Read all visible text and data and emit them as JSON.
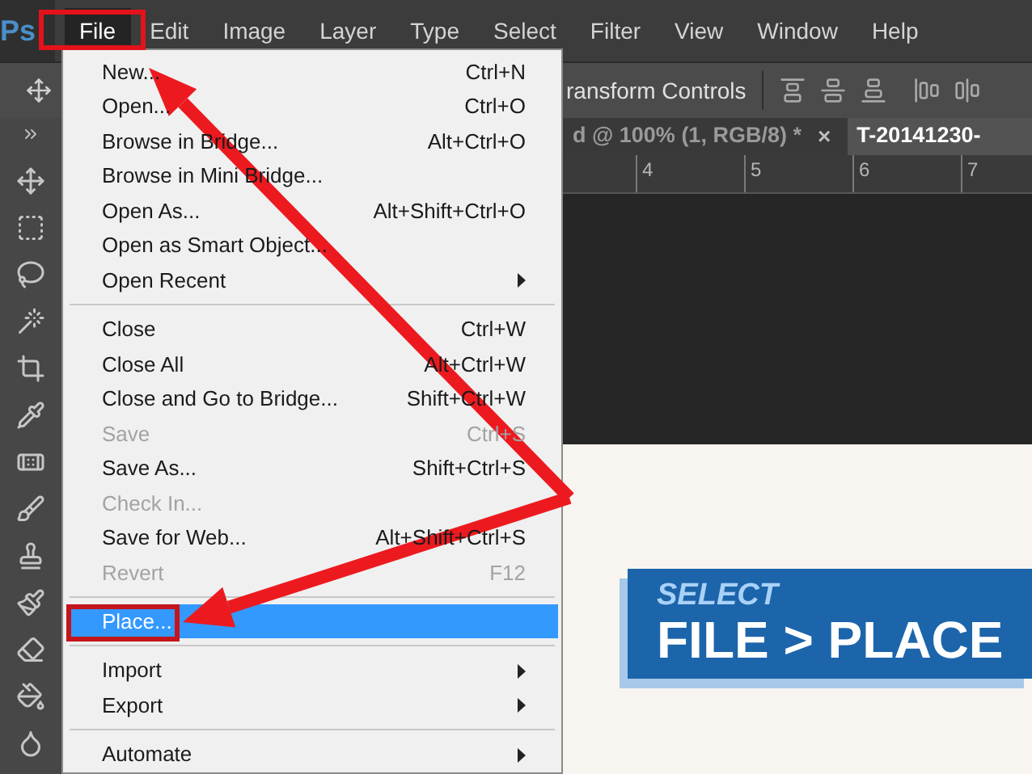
{
  "app": {
    "logo": "Ps"
  },
  "menubar": [
    {
      "label": "File",
      "selected": true
    },
    {
      "label": "Edit",
      "selected": false
    },
    {
      "label": "Image",
      "selected": false
    },
    {
      "label": "Layer",
      "selected": false
    },
    {
      "label": "Type",
      "selected": false
    },
    {
      "label": "Select",
      "selected": false
    },
    {
      "label": "Filter",
      "selected": false
    },
    {
      "label": "View",
      "selected": false
    },
    {
      "label": "Window",
      "selected": false
    },
    {
      "label": "Help",
      "selected": false
    }
  ],
  "options_bar": {
    "label": "ransform Controls"
  },
  "document_tabs": [
    {
      "label": "d @ 100% (1, RGB/8) *",
      "close": "×",
      "selected": false
    },
    {
      "label": "T-20141230-",
      "selected": true
    }
  ],
  "ruler": [
    "4",
    "5",
    "6",
    "7"
  ],
  "file_menu": [
    {
      "kind": "item",
      "label": "New...",
      "shortcut": "Ctrl+N",
      "disabled": false,
      "selected": false,
      "submenu": false
    },
    {
      "kind": "item",
      "label": "Open...",
      "shortcut": "Ctrl+O",
      "disabled": false,
      "selected": false,
      "submenu": false
    },
    {
      "kind": "item",
      "label": "Browse in Bridge...",
      "shortcut": "Alt+Ctrl+O",
      "disabled": false,
      "selected": false,
      "submenu": false
    },
    {
      "kind": "item",
      "label": "Browse in Mini Bridge...",
      "disabled": false,
      "selected": false,
      "submenu": false
    },
    {
      "kind": "item",
      "label": "Open As...",
      "shortcut": "Alt+Shift+Ctrl+O",
      "disabled": false,
      "selected": false,
      "submenu": false
    },
    {
      "kind": "item",
      "label": "Open as Smart Object...",
      "disabled": false,
      "selected": false,
      "submenu": false
    },
    {
      "kind": "item",
      "label": "Open Recent",
      "disabled": false,
      "selected": false,
      "submenu": true
    },
    {
      "kind": "separator"
    },
    {
      "kind": "item",
      "label": "Close",
      "shortcut": "Ctrl+W",
      "disabled": false,
      "selected": false,
      "submenu": false
    },
    {
      "kind": "item",
      "label": "Close All",
      "shortcut": "Alt+Ctrl+W",
      "disabled": false,
      "selected": false,
      "submenu": false
    },
    {
      "kind": "item",
      "label": "Close and Go to Bridge...",
      "shortcut": "Shift+Ctrl+W",
      "disabled": false,
      "selected": false,
      "submenu": false
    },
    {
      "kind": "item",
      "label": "Save",
      "shortcut": "Ctrl+S",
      "disabled": true,
      "selected": false,
      "submenu": false
    },
    {
      "kind": "item",
      "label": "Save As...",
      "shortcut": "Shift+Ctrl+S",
      "disabled": false,
      "selected": false,
      "submenu": false
    },
    {
      "kind": "item",
      "label": "Check In...",
      "disabled": true,
      "selected": false,
      "submenu": false
    },
    {
      "kind": "item",
      "label": "Save for Web...",
      "shortcut": "Alt+Shift+Ctrl+S",
      "disabled": false,
      "selected": false,
      "submenu": false
    },
    {
      "kind": "item",
      "label": "Revert",
      "shortcut": "F12",
      "disabled": true,
      "selected": false,
      "submenu": false
    },
    {
      "kind": "separator"
    },
    {
      "kind": "item",
      "label": "Place...",
      "disabled": false,
      "selected": true,
      "submenu": false
    },
    {
      "kind": "separator"
    },
    {
      "kind": "item",
      "label": "Import",
      "disabled": false,
      "selected": false,
      "submenu": true
    },
    {
      "kind": "item",
      "label": "Export",
      "disabled": false,
      "selected": false,
      "submenu": true
    },
    {
      "kind": "separator"
    },
    {
      "kind": "item",
      "label": "Automate",
      "disabled": false,
      "selected": false,
      "submenu": true
    }
  ],
  "banner": {
    "line_1": "SELECT",
    "line_2": "FILE > PLACE"
  }
}
